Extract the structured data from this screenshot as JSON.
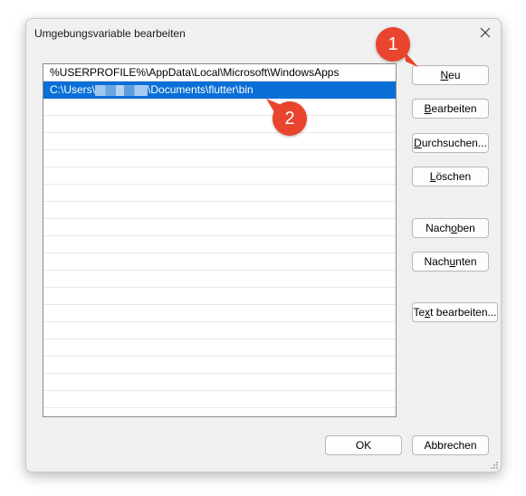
{
  "dialog": {
    "title": "Umgebungsvariable bearbeiten",
    "close_glyph": "✕"
  },
  "paths": {
    "items": [
      {
        "text": "%USERPROFILE%\\AppData\\Local\\Microsoft\\WindowsApps",
        "selected": false
      },
      {
        "prefix": "C:\\Users\\",
        "suffix": "\\Documents\\flutter\\bin",
        "selected": true
      }
    ]
  },
  "buttons": {
    "new": {
      "u": "N",
      "rest": "eu"
    },
    "edit": {
      "u": "B",
      "rest": "earbeiten"
    },
    "browse": {
      "u": "D",
      "rest": "urchsuchen..."
    },
    "delete": {
      "u": "L",
      "rest": "öschen"
    },
    "up": {
      "pre": "Nach ",
      "u": "o",
      "rest": "ben"
    },
    "down": {
      "pre": "Nach ",
      "u": "u",
      "rest": "nten"
    },
    "text_edit": {
      "pre": "Te",
      "u": "x",
      "rest": "t bearbeiten..."
    },
    "ok": "OK",
    "cancel": "Abbrechen"
  },
  "annotations": {
    "badge1": "1",
    "badge2": "2",
    "color": "#e8442e"
  },
  "colors": {
    "selection": "#0a6fd6"
  }
}
